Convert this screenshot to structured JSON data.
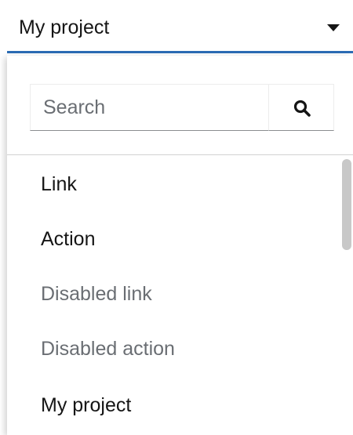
{
  "toggle": {
    "label": "My project"
  },
  "search": {
    "placeholder": "Search",
    "value": ""
  },
  "menu": {
    "items": [
      {
        "label": "Link",
        "disabled": false
      },
      {
        "label": "Action",
        "disabled": false
      },
      {
        "label": "Disabled link",
        "disabled": true
      },
      {
        "label": "Disabled action",
        "disabled": true
      },
      {
        "label": "My project",
        "disabled": false
      }
    ]
  },
  "colors": {
    "accent": "#2b6cb5",
    "text": "#151515",
    "disabled_text": "#6a6e73"
  },
  "icons": {
    "toggle": "caret-down-icon",
    "search": "search-icon"
  }
}
